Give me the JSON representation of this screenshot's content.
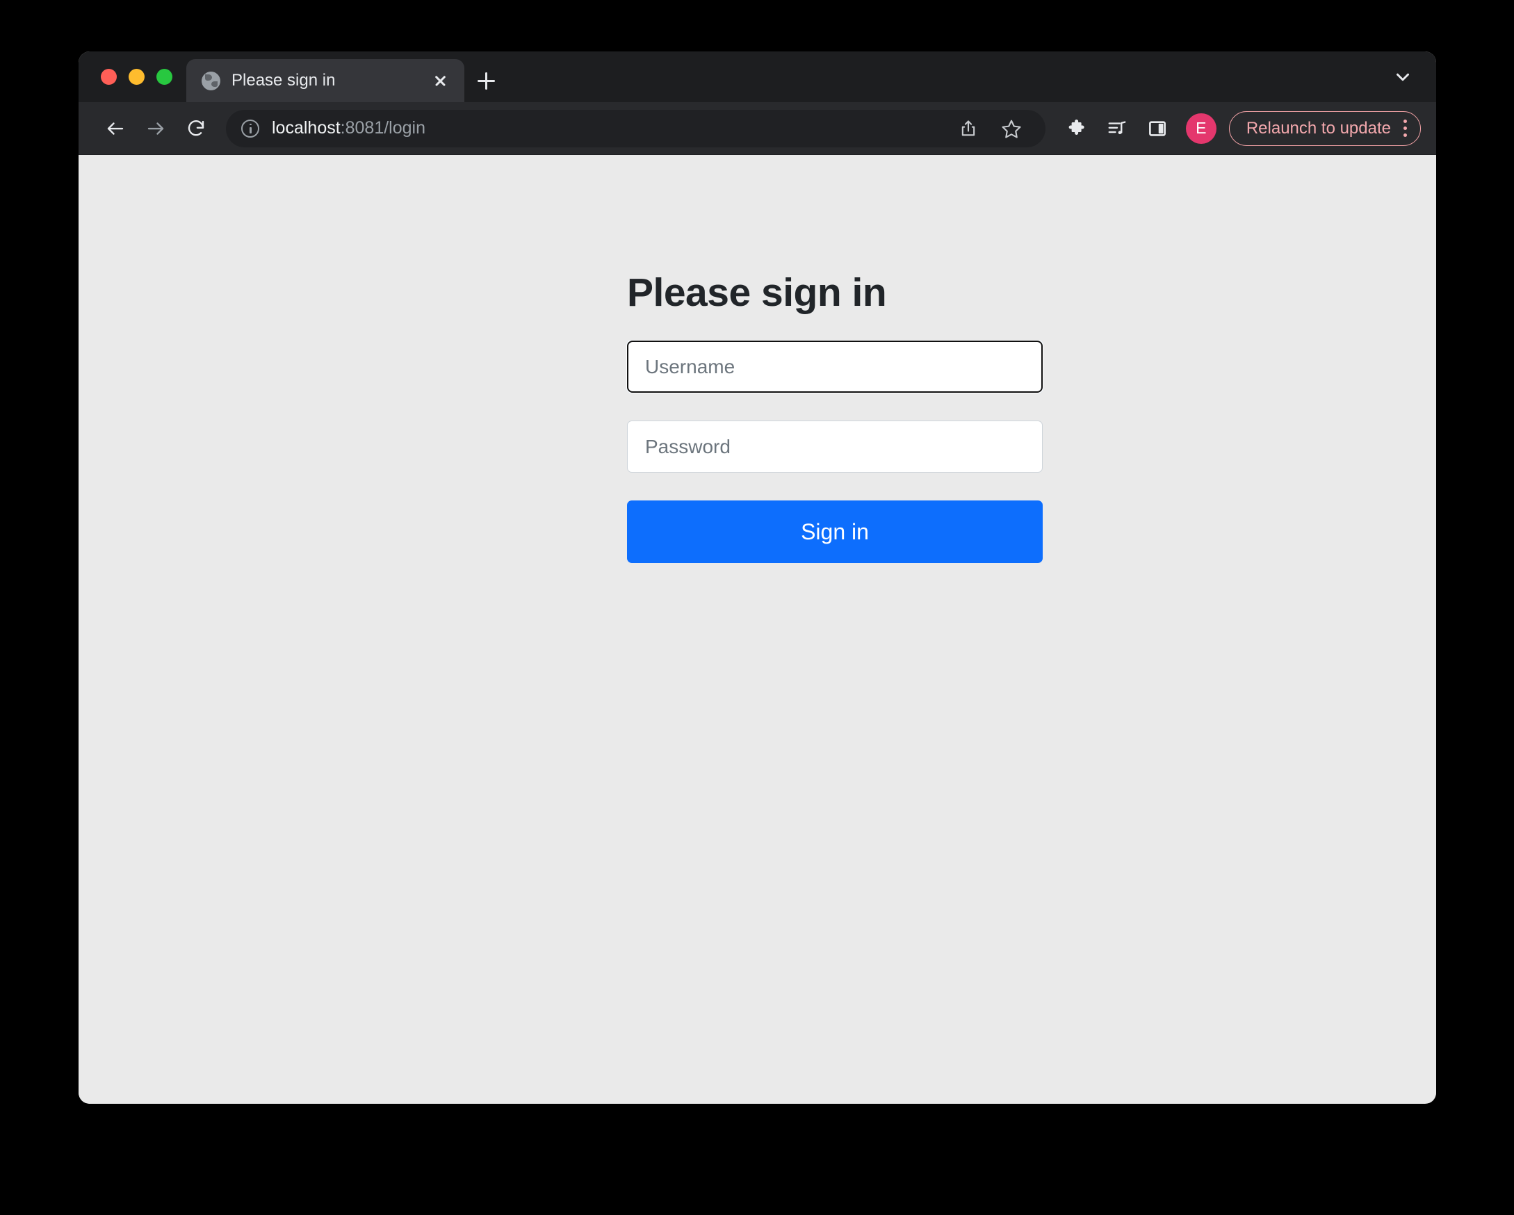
{
  "window": {
    "traffic_lights": [
      {
        "name": "close",
        "color": "#ff5f57"
      },
      {
        "name": "minimize",
        "color": "#febc2e"
      },
      {
        "name": "zoom",
        "color": "#28c840"
      }
    ]
  },
  "tabstrip": {
    "tabs": [
      {
        "title": "Please sign in",
        "favicon": "globe-icon",
        "active": true
      }
    ],
    "new_tab_icon": "plus-icon",
    "close_icon": "close-icon",
    "list_chevron_icon": "chevron-down-icon"
  },
  "toolbar": {
    "back_icon": "back-arrow-icon",
    "forward_icon": "forward-arrow-icon",
    "reload_icon": "reload-icon",
    "omnibox": {
      "security_icon": "info-circle-icon",
      "url_host": "localhost",
      "url_rest": ":8081/login",
      "share_icon": "share-icon",
      "bookmark_icon": "star-icon"
    },
    "extensions_icon": "puzzle-icon",
    "media_icon": "media-playlist-icon",
    "side_panel_icon": "side-panel-icon",
    "avatar": {
      "initial": "E",
      "color": "#e4376d"
    },
    "update": {
      "label": "Relaunch to update",
      "menu_icon": "kebab-menu-icon",
      "color": "#f3a8ad"
    }
  },
  "page": {
    "title": "Please sign in",
    "username": {
      "placeholder": "Username",
      "value": "",
      "focused": true
    },
    "password": {
      "placeholder": "Password",
      "value": ""
    },
    "submit_label": "Sign in",
    "accent_color": "#0d6efd",
    "background_color": "#eaeaea"
  }
}
